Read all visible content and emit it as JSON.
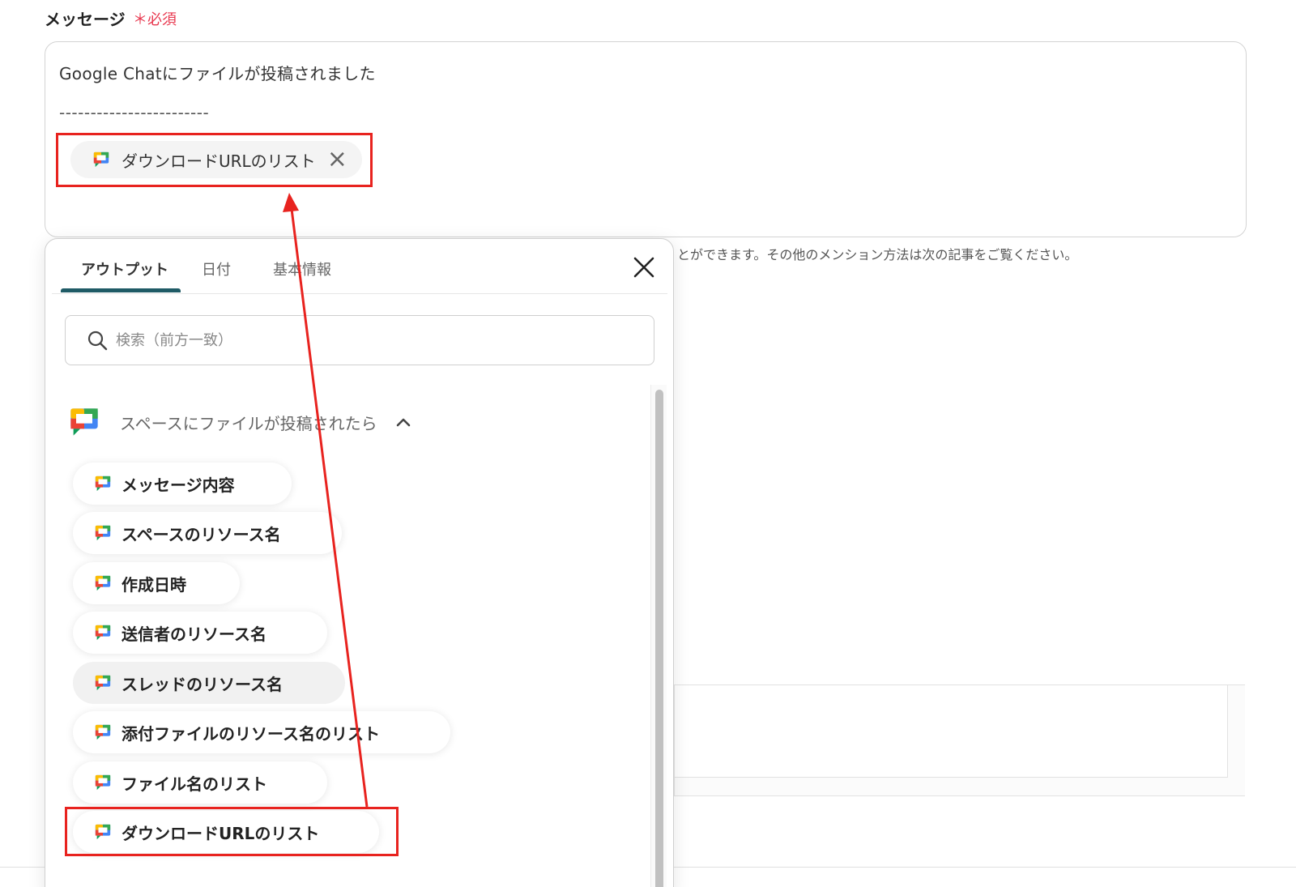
{
  "field": {
    "label": "メッセージ",
    "required": "＊必須"
  },
  "message": {
    "line1": "Google Chatにファイルが投稿されました",
    "line2": "------------------------",
    "token_label": "ダウンロードURLのリスト",
    "token_close": "×"
  },
  "helper_text": "とができます。その他のメンション方法は次の記事をご覧ください。",
  "popover": {
    "tabs": [
      {
        "label": "アウトプット"
      },
      {
        "label": "日付"
      },
      {
        "label": "基本情報"
      }
    ],
    "search_placeholder": "検索（前方一致）",
    "group_title": "スペースにファイルが投稿されたら",
    "items": [
      {
        "label": "メッセージ内容"
      },
      {
        "label": "スペースのリソース名"
      },
      {
        "label": "作成日時"
      },
      {
        "label": "送信者のリソース名"
      },
      {
        "label": "スレッドのリソース名"
      },
      {
        "label": "添付ファイルのリソース名のリスト"
      },
      {
        "label": "ファイル名のリスト"
      },
      {
        "label": "ダウンロードURLのリスト"
      }
    ]
  },
  "icons": {
    "chat": "google-chat-icon",
    "search": "search-icon",
    "close": "close-icon",
    "chevron": "chevron-up-icon"
  },
  "colors": {
    "required": "#e8384f",
    "tab_active_underline": "#1f5b66",
    "annotation": "#e8231f"
  }
}
